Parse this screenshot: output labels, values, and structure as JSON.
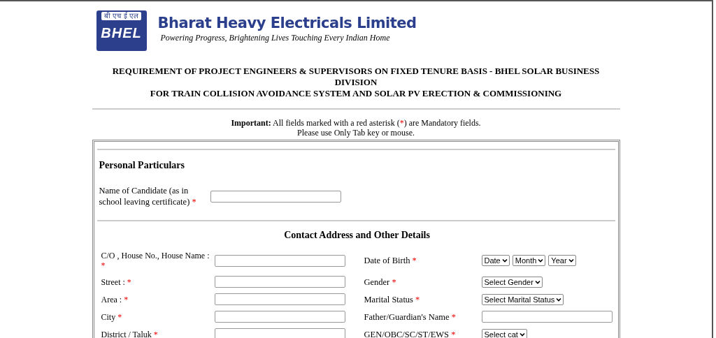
{
  "header": {
    "logo_hindi": "बी एच ई एल",
    "logo_abbr": "BHEL",
    "company": "Bharat Heavy Electricals Limited",
    "tagline": "Powering Progress, Brightening  Lives Touching  Every  Indian Home"
  },
  "title_lines": [
    "REQUIREMENT OF PROJECT ENGINEERS & SUPERVISORS ON FIXED TENURE BASIS - BHEL SOLAR BUSINESS DIVISION",
    "FOR TRAIN COLLISION AVOIDANCE SYSTEM AND SOLAR PV ERECTION & COMMISSIONING"
  ],
  "notice": {
    "label": "Important:",
    "before": "All fields marked with a red asterisk (",
    "mark": "*",
    "after": ") are Mandatory fields.",
    "line2": "Please use Only Tab key or mouse."
  },
  "personal": {
    "heading": "Personal Particulars",
    "rows": [
      {
        "label": "Name of Candidate (as in school leaving certificate)",
        "mark": "*",
        "kind": "text"
      }
    ]
  },
  "contact": {
    "heading": "Contact Address and Other Details",
    "rows": [
      {
        "left": {
          "label": "C/O , House No., House Name :",
          "mark": "*",
          "kind": "text"
        },
        "right": {
          "label": "Date of Birth",
          "mark": "*",
          "kind": "select",
          "values": [
            "Date",
            "Month",
            "Year"
          ]
        }
      },
      {
        "left": {
          "label": "Street :",
          "mark": "*",
          "kind": "text"
        },
        "right": {
          "label": "Gender",
          "mark": "*",
          "kind": "select",
          "values": [
            "Select Gender"
          ]
        }
      },
      {
        "left": {
          "label": "Area :",
          "mark": "*",
          "kind": "text"
        },
        "right": {
          "label": "Marital Status",
          "mark": "*",
          "kind": "select",
          "values": [
            "Select Marital Status"
          ]
        }
      },
      {
        "left": {
          "label": "City",
          "mark": "*",
          "kind": "text"
        },
        "right": {
          "label": "Father/Guardian's Name",
          "mark": "*",
          "kind": "text"
        }
      },
      {
        "left": {
          "label": "District / Taluk",
          "mark": "*",
          "kind": "text"
        },
        "right": {
          "label": "GEN/OBC/SC/ST/EWS",
          "mark": "*",
          "kind": "select",
          "values": [
            "Select cat"
          ]
        }
      }
    ]
  }
}
